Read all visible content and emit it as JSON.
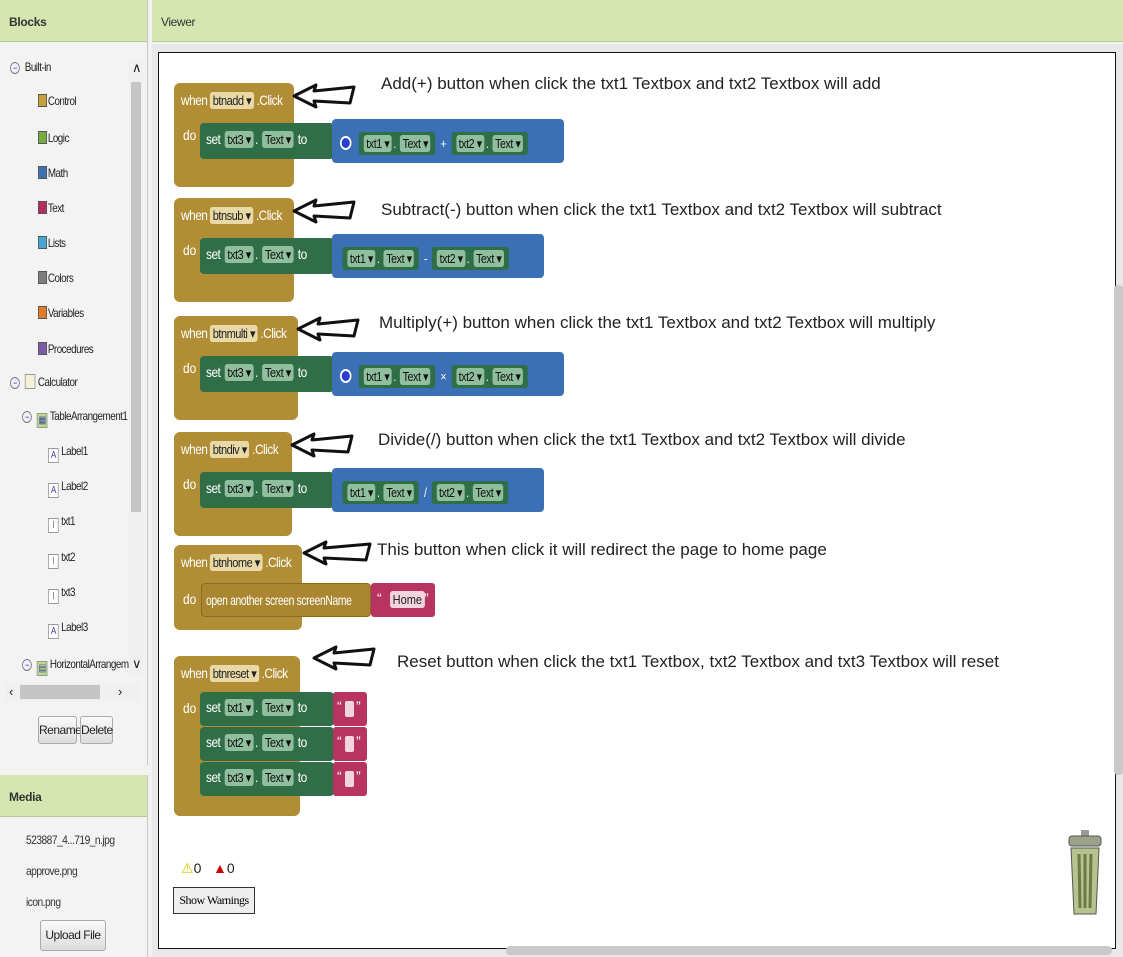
{
  "blocks_panel": {
    "title": "Blocks",
    "builtin": {
      "label": "Built-in",
      "items": [
        {
          "label": "Control",
          "color": "#c9a13b"
        },
        {
          "label": "Logic",
          "color": "#77ab41"
        },
        {
          "label": "Math",
          "color": "#3f71b5"
        },
        {
          "label": "Text",
          "color": "#b32d5e"
        },
        {
          "label": "Lists",
          "color": "#49a6d4"
        },
        {
          "label": "Colors",
          "color": "#7d7d7d"
        },
        {
          "label": "Variables",
          "color": "#e07b29"
        },
        {
          "label": "Procedures",
          "color": "#7c5ba6"
        }
      ]
    },
    "screen": {
      "label": "Calculator"
    },
    "components": [
      {
        "label": "TableArrangement1",
        "level": 1
      },
      {
        "label": "Label1",
        "level": 2
      },
      {
        "label": "Label2",
        "level": 2
      },
      {
        "label": "txt1",
        "level": 2
      },
      {
        "label": "txt2",
        "level": 2
      },
      {
        "label": "txt3",
        "level": 2
      },
      {
        "label": "Label3",
        "level": 2
      },
      {
        "label": "HorizontalArrangeme",
        "level": 1
      }
    ],
    "rename_label": "Rename",
    "delete_label": "Delete"
  },
  "media_panel": {
    "title": "Media",
    "files": [
      "523887_4...719_n.jpg",
      "approve.png",
      "icon.png"
    ],
    "upload_label": "Upload File ..."
  },
  "viewer": {
    "title": "Viewer",
    "warnings_count": "0",
    "errors_count": "0",
    "show_warnings_label": "Show Warnings"
  },
  "code_blocks": [
    {
      "when": "when",
      "button": "btnadd",
      "event": ".Click",
      "do": "do",
      "set": "set",
      "target": "txt3",
      "prop": "Text",
      "to": "to",
      "a": "txt1",
      "op": "+",
      "b": "txt2",
      "comment": "Add(+) button when click the txt1 Textbox and txt2 Textbox will add"
    },
    {
      "when": "when",
      "button": "btnsub",
      "event": ".Click",
      "do": "do",
      "set": "set",
      "target": "txt3",
      "prop": "Text",
      "to": "to",
      "a": "txt1",
      "op": "-",
      "b": "txt2",
      "comment": "Subtract(-) button when click the txt1 Textbox and txt2 Textbox will subtract"
    },
    {
      "when": "when",
      "button": "btnmulti",
      "event": ".Click",
      "do": "do",
      "set": "set",
      "target": "txt3",
      "prop": "Text",
      "to": "to",
      "a": "txt1",
      "op": "×",
      "b": "txt2",
      "comment": "Multiply(+) button when click the txt1 Textbox and txt2 Textbox will multiply"
    },
    {
      "when": "when",
      "button": "btndiv",
      "event": ".Click",
      "do": "do",
      "set": "set",
      "target": "txt3",
      "prop": "Text",
      "to": "to",
      "a": "txt1",
      "op": "/",
      "b": "txt2",
      "comment": "Divide(/) button when click the txt1 Textbox and txt2 Textbox will divide"
    }
  ],
  "home_block": {
    "when": "when",
    "button": "btnhome",
    "event": ".Click",
    "do": "do",
    "action": "open another screen screenName",
    "value": "Home",
    "comment": "This button when click it will redirect the page to home page"
  },
  "reset_block": {
    "when": "when",
    "button": "btnreset",
    "event": ".Click",
    "do": "do",
    "set": "set",
    "prop": "Text",
    "to": "to",
    "targets": [
      "txt1",
      "txt2",
      "txt3"
    ],
    "comment": "Reset button when click the txt1 Textbox, txt2 Textbox and txt3 Textbox will reset"
  },
  "icons": {
    "prop_dropdown": "▾",
    "string_quote_open": "“",
    "string_quote_close": "”"
  },
  "prop_label": "Text",
  "colors": {
    "event_block": "#b18e35",
    "set_block": "#2f6e47",
    "math_block": "#3b6fb6",
    "text_block": "#b6345f",
    "header_bar": "#d6e6b0"
  }
}
